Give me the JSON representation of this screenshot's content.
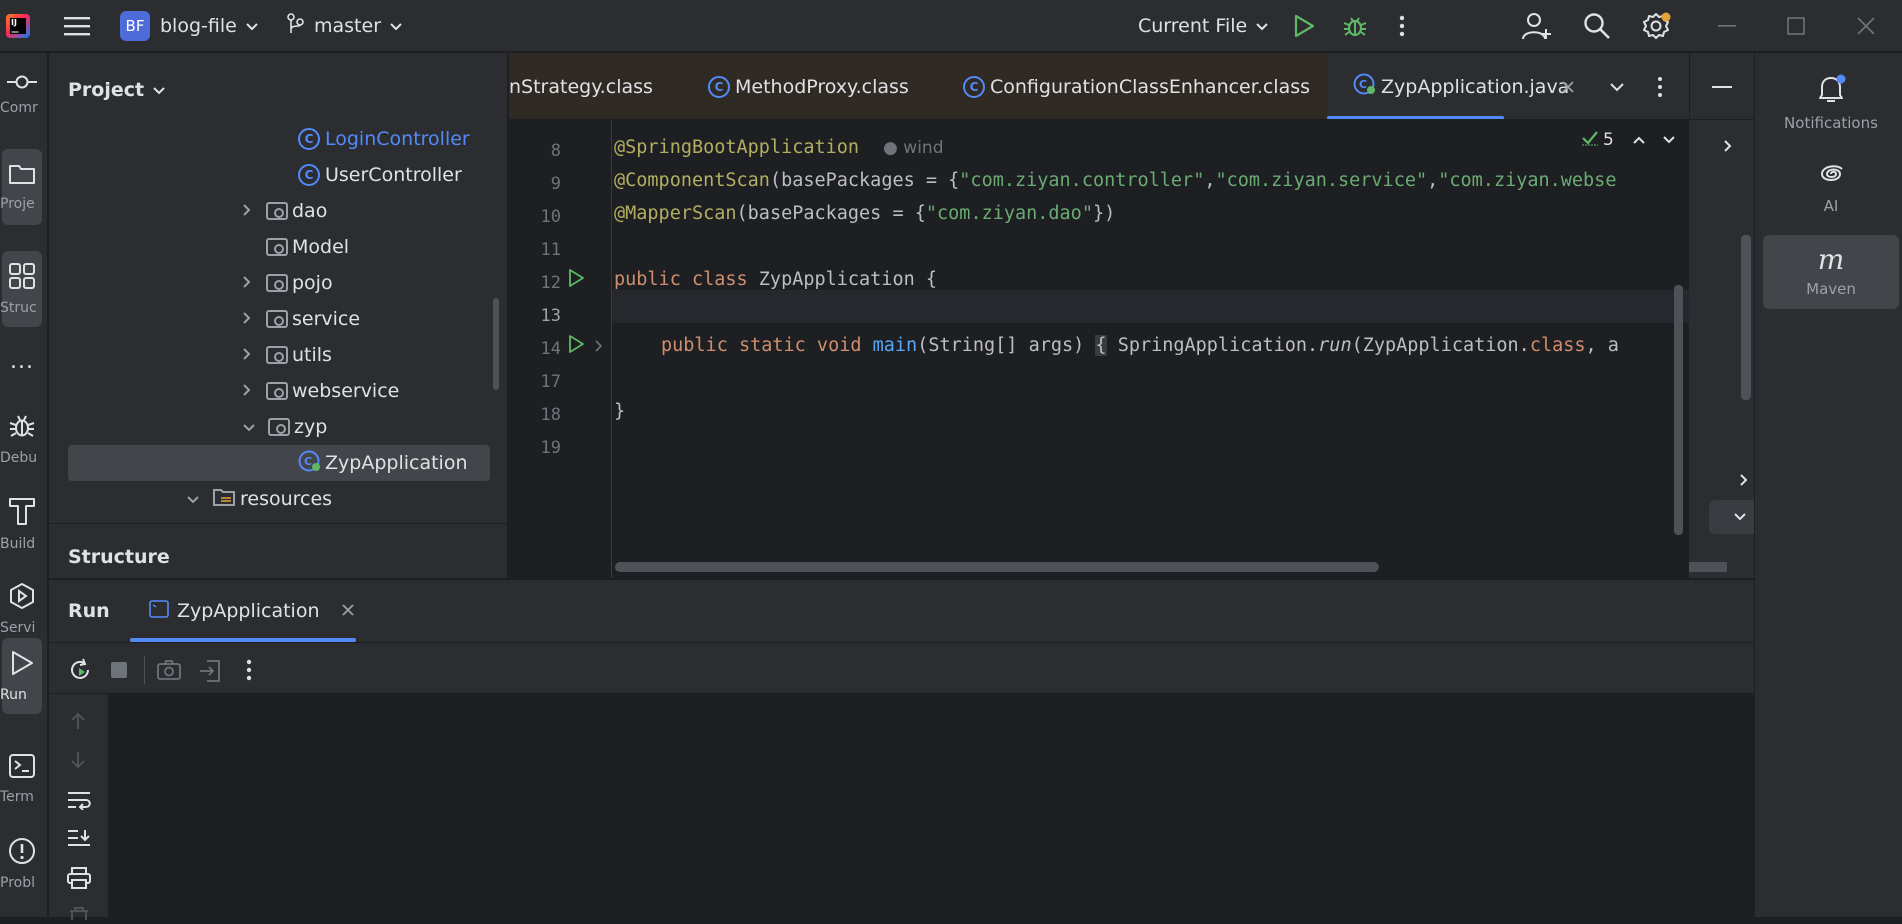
{
  "titlebar": {
    "project_badge": "BF",
    "project_name": "blog-file",
    "branch": "master",
    "run_config": "Current File"
  },
  "left_stripe": [
    {
      "label": "Comr"
    },
    {
      "label": "Proje"
    },
    {
      "label": "Struc"
    },
    {
      "label": "..."
    },
    {
      "label": "Debu"
    },
    {
      "label": "Build"
    },
    {
      "label": "Servi"
    },
    {
      "label": "Run"
    },
    {
      "label": "Term"
    },
    {
      "label": "Probl"
    }
  ],
  "project_panel": {
    "title": "Project",
    "structure_title": "Structure",
    "tree": [
      {
        "label": "LoginController",
        "type": "class",
        "color": "#548af7"
      },
      {
        "label": "UserController",
        "type": "class"
      },
      {
        "label": "dao",
        "type": "folder",
        "chevron": "›"
      },
      {
        "label": "Model",
        "type": "folder"
      },
      {
        "label": "pojo",
        "type": "folder",
        "chevron": "›"
      },
      {
        "label": "service",
        "type": "folder",
        "chevron": "›"
      },
      {
        "label": "utils",
        "type": "folder",
        "chevron": "›"
      },
      {
        "label": "webservice",
        "type": "folder",
        "chevron": "›"
      },
      {
        "label": "zyp",
        "type": "folder",
        "chevron": "⌄"
      },
      {
        "label": "ZypApplication",
        "type": "springclass",
        "selected": true
      },
      {
        "label": "resources",
        "type": "resources",
        "chevron": "⌄"
      }
    ]
  },
  "editor_tabs": [
    {
      "label": "nStrategy.class"
    },
    {
      "label": "MethodProxy.class"
    },
    {
      "label": "ConfigurationClassEnhancer.class"
    },
    {
      "label": "ZypApplication.java",
      "active": true
    }
  ],
  "editor": {
    "inspection_count": "5",
    "author": "wind",
    "line_numbers": [
      "8",
      "9",
      "10",
      "11",
      "12",
      "13",
      "14",
      "17",
      "18",
      "19"
    ],
    "lines": {
      "l8": "@SpringBootApplication",
      "l9_ann": "@ComponentScan",
      "l9_rest": "(basePackages = {",
      "l9_s1": "\"com.ziyan.controller\"",
      "l9_s2": "\"com.ziyan.service\"",
      "l9_s3": "\"com.ziyan.webse",
      "l10_ann": "@MapperScan",
      "l10_rest": "(basePackages = {",
      "l10_s1": "\"com.ziyan.dao\"",
      "l10_end": "})",
      "l12_kw": "public class",
      "l12_rest": " ZypApplication {",
      "l14_kw": "public static void",
      "l14_fn": "main",
      "l14_args": "(String[] args)",
      "l14_brace": "{",
      "l14_call": "SpringApplication.",
      "l14_run": "run",
      "l14_tail": "(ZypApplication.",
      "l14_cls": "class",
      "l14_end": ", a",
      "l17": "",
      "l18": "}"
    }
  },
  "right_stripe": [
    {
      "label": "Notifications"
    },
    {
      "label": "AI"
    },
    {
      "label": "Maven"
    }
  ],
  "run_panel": {
    "title": "Run",
    "tab": "ZypApplication"
  }
}
